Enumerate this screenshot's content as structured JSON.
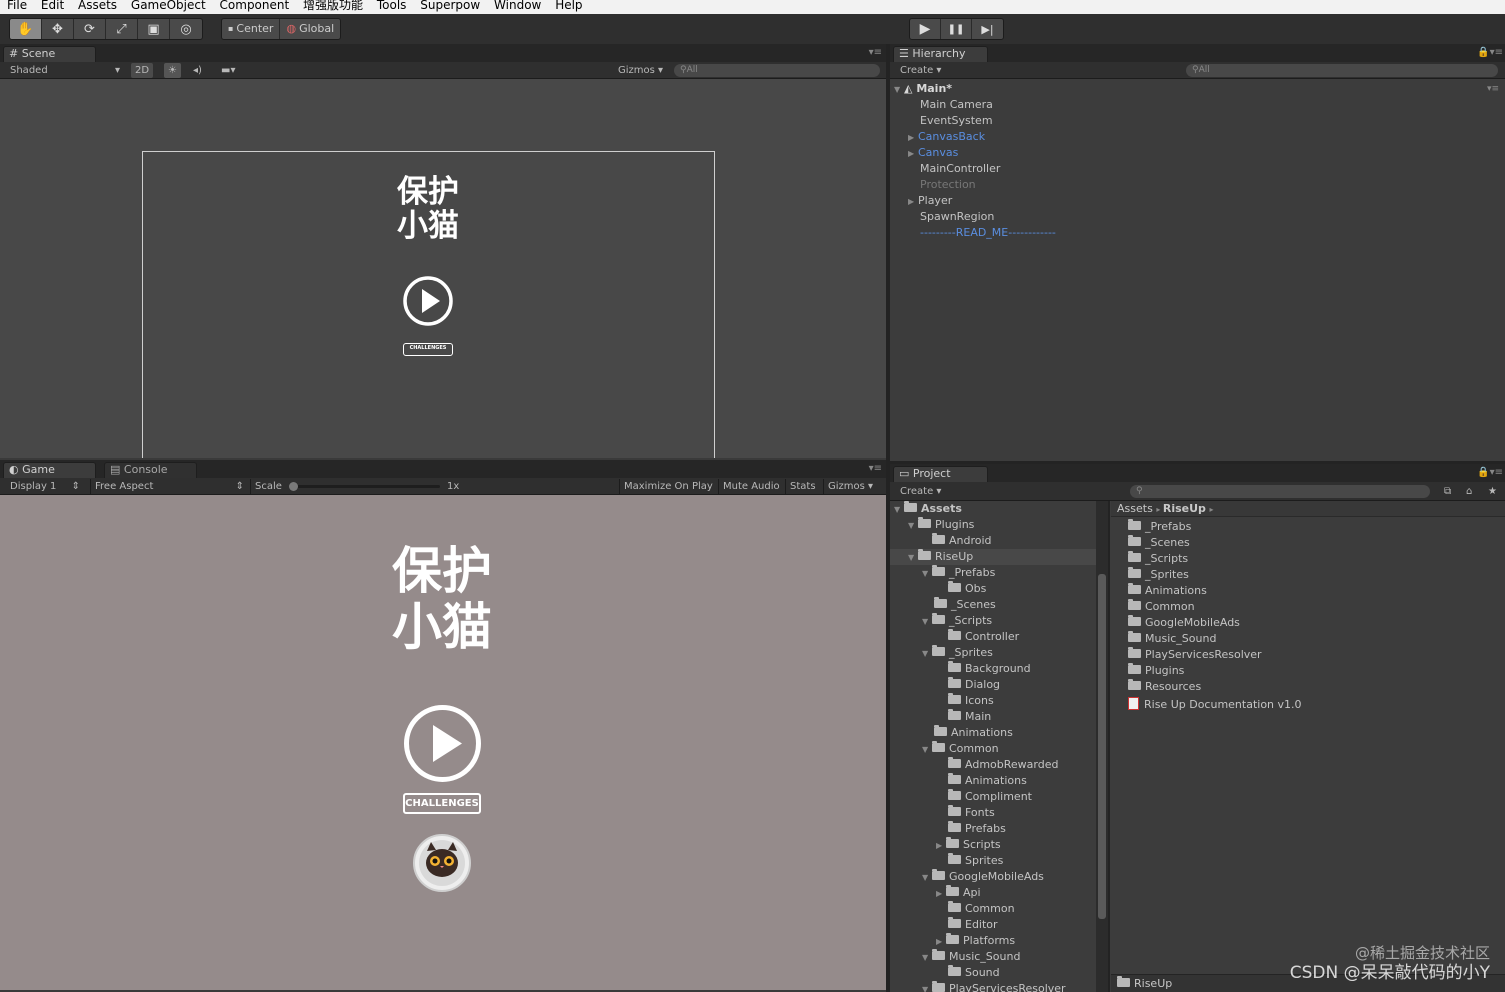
{
  "menu": [
    "File",
    "Edit",
    "Assets",
    "GameObject",
    "Component",
    "增强版功能",
    "Tools",
    "Superpow",
    "Window",
    "Help"
  ],
  "toolbar": {
    "tools": [
      "hand-icon",
      "move-icon",
      "rotate-icon",
      "scale-icon",
      "rect-icon",
      "transform-icon"
    ],
    "pivot_label": "Center",
    "space_label": "Global",
    "play": [
      "▶",
      "❚❚",
      "▶|"
    ]
  },
  "scene": {
    "tab_label": "Scene",
    "shading": "Shaded",
    "mode_2d": "2D",
    "gizmos": "Gizmos",
    "search_placeholder": "All",
    "logo_line1": "保护",
    "logo_line2": "小猫",
    "challenges": "CHALLENGES"
  },
  "game": {
    "tab_label": "Game",
    "console_tab": "Console",
    "display": "Display 1",
    "aspect": "Free Aspect",
    "scale_label": "Scale",
    "scale_value": "1x",
    "maximize": "Maximize On Play",
    "mute": "Mute Audio",
    "stats": "Stats",
    "gizmos": "Gizmos",
    "logo_line1": "保护",
    "logo_line2": "小猫",
    "challenges": "CHALLENGES"
  },
  "hierarchy": {
    "tab_label": "Hierarchy",
    "create": "Create",
    "search_placeholder": "All",
    "scene_name": "Main*",
    "items": [
      {
        "label": "Main Camera"
      },
      {
        "label": "EventSystem"
      },
      {
        "label": "CanvasBack"
      },
      {
        "label": "Canvas"
      },
      {
        "label": "MainController"
      },
      {
        "label": "Protection"
      },
      {
        "label": "Player"
      },
      {
        "label": "SpawnRegion"
      },
      {
        "label": "---------READ_ME------------"
      }
    ]
  },
  "project": {
    "tab_label": "Project",
    "create": "Create",
    "breadcrumb_root": "Assets",
    "breadcrumb_current": "RiseUp",
    "tree": [
      {
        "label": "Assets"
      },
      {
        "label": "Plugins"
      },
      {
        "label": "Android"
      },
      {
        "label": "RiseUp"
      },
      {
        "label": "_Prefabs"
      },
      {
        "label": "Obs"
      },
      {
        "label": "_Scenes"
      },
      {
        "label": "_Scripts"
      },
      {
        "label": "Controller"
      },
      {
        "label": "_Sprites"
      },
      {
        "label": "Background"
      },
      {
        "label": "Dialog"
      },
      {
        "label": "Icons"
      },
      {
        "label": "Main"
      },
      {
        "label": "Animations"
      },
      {
        "label": "Common"
      },
      {
        "label": "AdmobRewarded"
      },
      {
        "label": "Animations"
      },
      {
        "label": "Compliment"
      },
      {
        "label": "Fonts"
      },
      {
        "label": "Prefabs"
      },
      {
        "label": "Scripts"
      },
      {
        "label": "Sprites"
      },
      {
        "label": "GoogleMobileAds"
      },
      {
        "label": "Api"
      },
      {
        "label": "Common"
      },
      {
        "label": "Editor"
      },
      {
        "label": "Platforms"
      },
      {
        "label": "Music_Sound"
      },
      {
        "label": "Sound"
      },
      {
        "label": "PlayServicesResolver"
      }
    ],
    "contents": [
      {
        "label": "_Prefabs",
        "icon": "folder-icon"
      },
      {
        "label": "_Scenes",
        "icon": "folder-icon"
      },
      {
        "label": "_Scripts",
        "icon": "folder-icon"
      },
      {
        "label": "_Sprites",
        "icon": "folder-icon"
      },
      {
        "label": "Animations",
        "icon": "folder-icon"
      },
      {
        "label": "Common",
        "icon": "folder-icon"
      },
      {
        "label": "GoogleMobileAds",
        "icon": "folder-icon"
      },
      {
        "label": "Music_Sound",
        "icon": "folder-icon"
      },
      {
        "label": "PlayServicesResolver",
        "icon": "folder-icon"
      },
      {
        "label": "Plugins",
        "icon": "folder-icon"
      },
      {
        "label": "Resources",
        "icon": "folder-icon"
      },
      {
        "label": "Rise Up Documentation v1.0",
        "icon": "pdf-icon"
      }
    ],
    "footer_path": "RiseUp"
  },
  "watermark": {
    "line1": "@稀土掘金技术社区",
    "line2": "CSDN @呆呆敲代码的小Y"
  },
  "colors": {
    "game_background": "#958b8b",
    "scene_background": "#484848",
    "link_blue": "#5a8ee0"
  }
}
